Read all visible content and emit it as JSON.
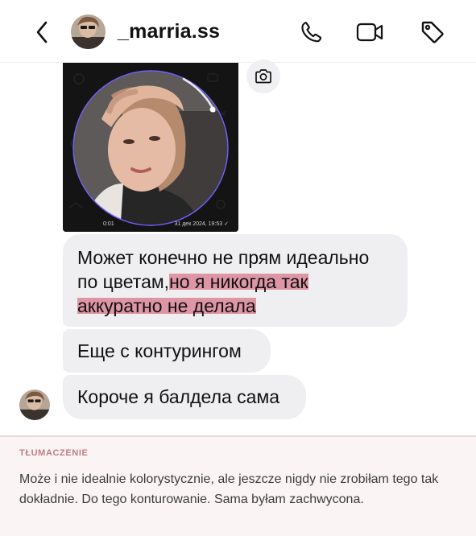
{
  "header": {
    "username": "_marria.ss",
    "icons": [
      "back-chevron-icon",
      "phone-icon",
      "video-call-icon",
      "tag-icon"
    ]
  },
  "video_message": {
    "duration": "0:01",
    "timestamp": "31 дек 2024, 19:53 ✓"
  },
  "messages": [
    {
      "parts": [
        {
          "text": "Может конечно не прям идеально по цветам,",
          "highlight": false
        },
        {
          "text": "но я никогда так аккуратно не делала",
          "highlight": true
        }
      ]
    },
    {
      "text": "Еще с контурингом"
    },
    {
      "text": "Короче я балдела сама"
    }
  ],
  "translation": {
    "title": "TŁUMACZENIE",
    "text": "Może i nie idealnie kolorystycznie, ale jeszcze nigdy nie zrobiłam tego tak dokładnie. Do tego konturowanie. Sama byłam zachwycona."
  },
  "colors": {
    "highlight": "#d8788c",
    "bubble": "#efeff1",
    "translation_bg": "#fbf4f5",
    "translation_title": "#bf7d86"
  }
}
